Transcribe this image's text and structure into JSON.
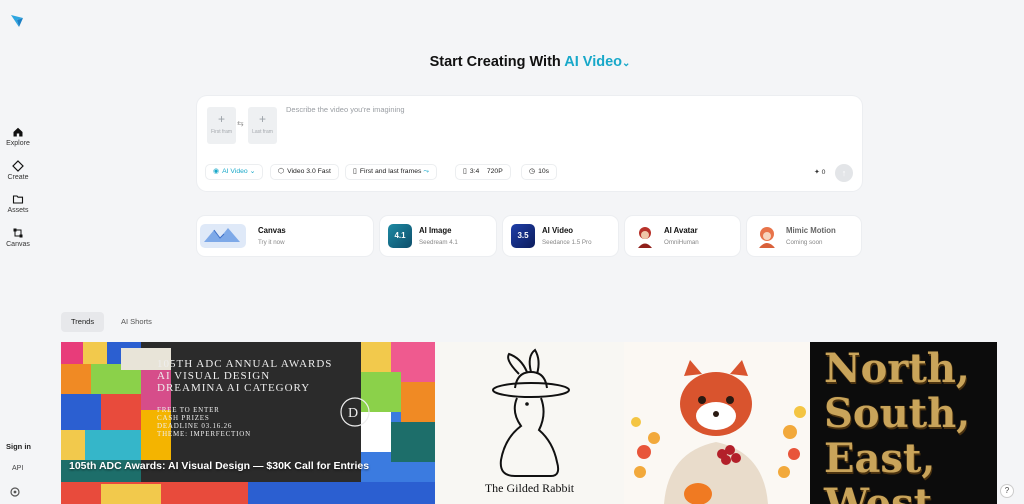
{
  "sidebar": {
    "items": [
      {
        "label": "Explore",
        "icon": "home-icon"
      },
      {
        "label": "Create",
        "icon": "diamond-icon"
      },
      {
        "label": "Assets",
        "icon": "folder-icon"
      },
      {
        "label": "Canvas",
        "icon": "canvas-icon"
      }
    ],
    "sign_in": "Sign in",
    "api": "API"
  },
  "headline": {
    "prefix": "Start Creating With",
    "accent": "AI Video",
    "chevron": "⌄"
  },
  "prompt": {
    "first_frame": "First fram",
    "last_frame": "Last fram",
    "placeholder": "Describe the video you're imagining",
    "chips": {
      "mode": "AI Video",
      "model": "Video 3.0 Fast",
      "frames": "First and last frames",
      "ratio": "3:4",
      "resolution": "720P",
      "duration": "10s"
    },
    "credits": "0"
  },
  "tools": [
    {
      "title": "Canvas",
      "subtitle": "Try it now"
    },
    {
      "title": "AI Image",
      "subtitle": "Seedream 4.1",
      "badge": "4.1"
    },
    {
      "title": "AI Video",
      "subtitle": "Seedance 1.5 Pro",
      "badge": "3.5"
    },
    {
      "title": "AI Avatar",
      "subtitle": "OmniHuman"
    },
    {
      "title": "Mimic Motion",
      "subtitle": "Coming soon"
    }
  ],
  "tabs": [
    "Trends",
    "AI Shorts"
  ],
  "gallery": {
    "adc": {
      "line1": "105TH ADC ANNUAL AWARDS",
      "line2": "AI VISUAL DESIGN",
      "line3": "DREAMINA AI CATEGORY",
      "small1": "FREE TO ENTER",
      "small2": "CASH PRIZES",
      "small3": "DEADLINE 03.16.26",
      "small4": "THEME: IMPERFECTION",
      "caption": "105th ADC Awards: AI Visual Design — $30K Call for Entries"
    },
    "rabbit_caption": "The Gilded Rabbit",
    "nsew": [
      "North,",
      "South,",
      "East,",
      "West"
    ]
  },
  "colors": {
    "accent": "#18a8c9",
    "background": "#f4f5f7"
  }
}
